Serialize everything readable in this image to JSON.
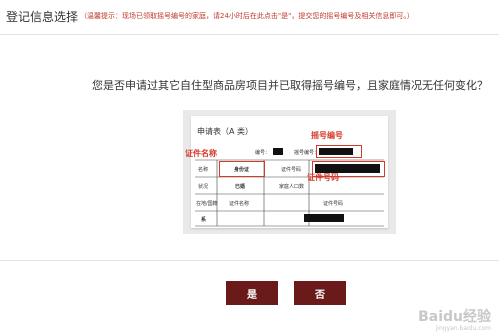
{
  "page": {
    "title": "登记信息选择",
    "notice": "（温馨提示：现场已领取摇号编号的家庭，请24小时后在此点击\"是\"，提交您的摇号编号及相关信息即可。）",
    "question": "您是否申请过其它自住型商品房项目并已取得摇号编号，且家庭情况无任何变化？"
  },
  "form_image": {
    "sheet_title": "申请表（A 类）",
    "serial_label": "编号：",
    "lottery_label": "摇号编号：",
    "row1_col1": "名称",
    "row1_col2": "身份证",
    "row1_col3": "证件号码",
    "row2_col1": "状况",
    "row2_col2": "已婚",
    "row2_col3": "家庭人口数",
    "row3_col1": "在地/国籍",
    "row3_col2": "证件名称",
    "row3_col3": "证件号码",
    "row4_col1": "系",
    "annotations": {
      "lottery_number": "摇号编号",
      "id_name": "证件名称",
      "id_number": "证件号码"
    }
  },
  "buttons": {
    "yes": "是",
    "no": "否"
  },
  "watermark": {
    "brand": "Baidu经验",
    "url": "jingyan.baidu.com"
  }
}
